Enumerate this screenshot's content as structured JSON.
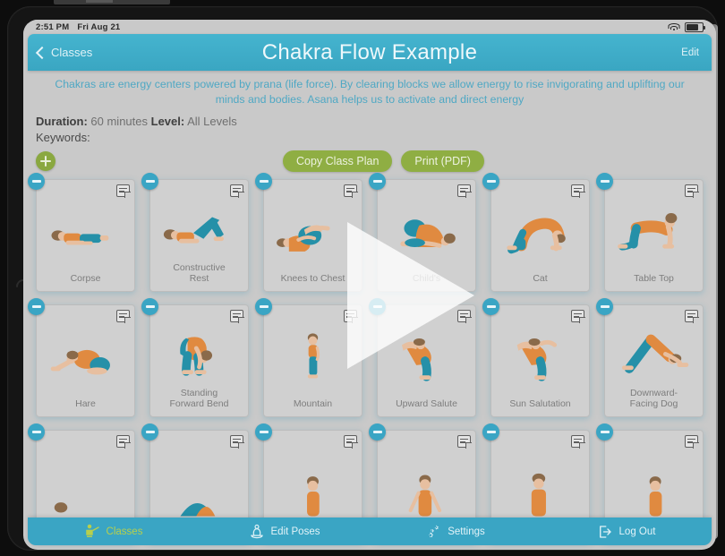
{
  "status_bar": {
    "time": "2:51 PM",
    "date": "Fri Aug 21",
    "wifi_icon": "wifi-icon",
    "battery_icon": "battery-icon"
  },
  "nav": {
    "back_label": "Classes",
    "back_icon": "chevron-left-icon",
    "title": "Chakra Flow Example",
    "edit_label": "Edit"
  },
  "description": "Chakras are energy centers powered by prana (life force).  By clearing blocks we allow energy to rise invigorating and uplifting our minds and bodies.  Asana helps us to activate and direct energy",
  "meta": {
    "duration_label": "Duration:",
    "duration_value": "60 minutes",
    "level_label": "Level:",
    "level_value": "All Levels",
    "keywords_label": "Keywords:",
    "keywords_value": ""
  },
  "actions": {
    "add_icon": "plus-icon",
    "copy_label": "Copy Class Plan",
    "print_label": "Print (PDF)"
  },
  "poses": [
    {
      "name": "Corpse",
      "figure": "corpse"
    },
    {
      "name": "Constructive\nRest",
      "figure": "constructive-rest"
    },
    {
      "name": "Knees to Chest",
      "figure": "knees-to-chest"
    },
    {
      "name": "Child's",
      "figure": "childs"
    },
    {
      "name": "Cat",
      "figure": "cat"
    },
    {
      "name": "Table Top",
      "figure": "table-top"
    },
    {
      "name": "Hare",
      "figure": "hare"
    },
    {
      "name": "Standing\nForward Bend",
      "figure": "standing-forward-bend"
    },
    {
      "name": "Mountain",
      "figure": "mountain"
    },
    {
      "name": "Upward Salute",
      "figure": "upward-salute"
    },
    {
      "name": "Sun Salutation",
      "figure": "sun-salutation"
    },
    {
      "name": "Downward-\nFacing Dog",
      "figure": "downward-facing-dog"
    },
    {
      "name": "",
      "figure": "row3-a"
    },
    {
      "name": "",
      "figure": "row3-b"
    },
    {
      "name": "",
      "figure": "row3-c"
    },
    {
      "name": "",
      "figure": "row3-d"
    },
    {
      "name": "",
      "figure": "row3-e"
    },
    {
      "name": "",
      "figure": "row3-f"
    }
  ],
  "card_icons": {
    "remove_icon": "minus-circle-icon",
    "note_icon": "note-icon"
  },
  "play_overlay": {
    "icon": "play-triangle-icon"
  },
  "tabs": [
    {
      "label": "Classes",
      "icon": "teacher-icon",
      "active": true
    },
    {
      "label": "Edit Poses",
      "icon": "meditation-icon",
      "active": false
    },
    {
      "label": "Settings",
      "icon": "gears-icon",
      "active": false
    },
    {
      "label": "Log Out",
      "icon": "logout-icon",
      "active": false
    }
  ],
  "colors": {
    "teal": "#3aa5c4",
    "teal_light": "#45b4cf",
    "green": "#8fae43",
    "description_text": "#4fa8c4",
    "card_bg": "#d0d0d0",
    "screen_bg": "#c9c9c9",
    "skin": "#e7bfa0",
    "hair": "#8a6a4a",
    "top": "#e08a40",
    "pants": "#2590a8"
  }
}
